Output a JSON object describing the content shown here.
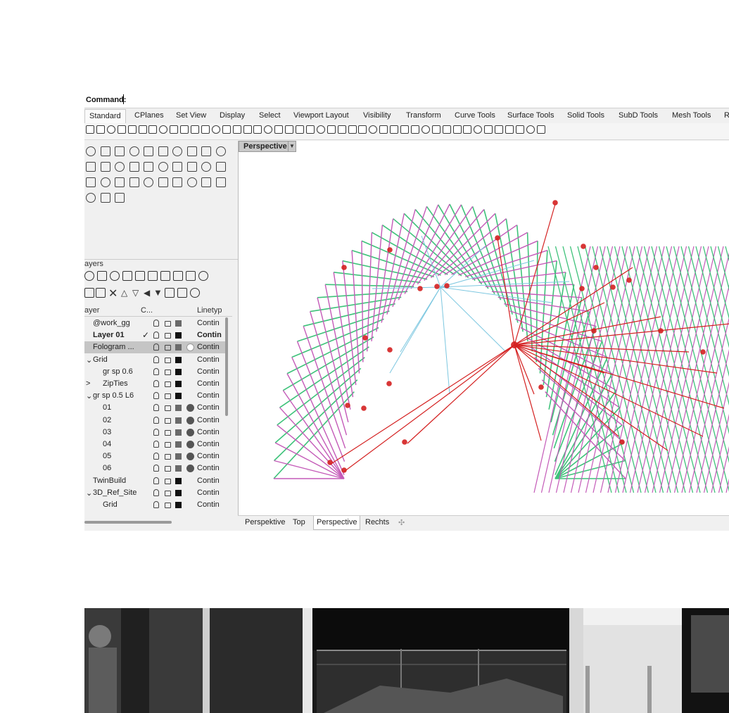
{
  "command_bar": {
    "label": "Command:"
  },
  "ribbon_tabs": [
    "Standard",
    "CPlanes",
    "Set View",
    "Display",
    "Select",
    "Viewport Layout",
    "Visibility",
    "Transform",
    "Curve Tools",
    "Surface Tools",
    "Solid Tools",
    "SubD Tools",
    "Mesh Tools",
    "R"
  ],
  "layers_panel": {
    "title": "ayers",
    "columns": {
      "name": "ayer",
      "color": "C...",
      "linetype": "Linetyp"
    },
    "rows": [
      {
        "prefix": "",
        "name": "@work_gg",
        "linetype": "Contin",
        "swatch": "#6a6a6a",
        "material": ""
      },
      {
        "prefix": "",
        "name": "Layer 01",
        "linetype": "Contin",
        "swatch": "#111111",
        "material": "",
        "current": "✓",
        "bold": true
      },
      {
        "prefix": "",
        "name": "Fologram ...",
        "linetype": "Contin",
        "swatch": "#6a6a6a",
        "material": "#ffffff",
        "selected": true
      },
      {
        "prefix": "⌄",
        "name": "Grid",
        "linetype": "Contin",
        "swatch": "#111111",
        "material": ""
      },
      {
        "prefix": "",
        "name": "gr sp 0.6",
        "linetype": "Contin",
        "swatch": "#111111",
        "material": ""
      },
      {
        "prefix": ">",
        "name": "ZipTies",
        "linetype": "Contin",
        "swatch": "#111111",
        "material": ""
      },
      {
        "prefix": "⌄",
        "name": "gr sp 0.5 L6",
        "linetype": "Contin",
        "swatch": "#111111",
        "material": ""
      },
      {
        "prefix": "",
        "name": "01",
        "linetype": "Contin",
        "swatch": "#6a6a6a",
        "material": "#555555"
      },
      {
        "prefix": "",
        "name": "02",
        "linetype": "Contin",
        "swatch": "#6a6a6a",
        "material": "#555555"
      },
      {
        "prefix": "",
        "name": "03",
        "linetype": "Contin",
        "swatch": "#6a6a6a",
        "material": "#555555"
      },
      {
        "prefix": "",
        "name": "04",
        "linetype": "Contin",
        "swatch": "#6a6a6a",
        "material": "#555555"
      },
      {
        "prefix": "",
        "name": "05",
        "linetype": "Contin",
        "swatch": "#6a6a6a",
        "material": "#555555"
      },
      {
        "prefix": "",
        "name": "06",
        "linetype": "Contin",
        "swatch": "#6a6a6a",
        "material": "#555555"
      },
      {
        "prefix": "",
        "name": "TwinBuild",
        "linetype": "Contin",
        "swatch": "#111111",
        "material": ""
      },
      {
        "prefix": "⌄",
        "name": "3D_Ref_Site",
        "linetype": "Contin",
        "swatch": "#111111",
        "material": ""
      },
      {
        "prefix": "",
        "name": "Grid",
        "linetype": "Contin",
        "swatch": "#111111",
        "material": ""
      }
    ]
  },
  "viewport": {
    "label": "Perspective",
    "colors": {
      "green": "#3ec27a",
      "magenta": "#c45ab8",
      "red": "#d42020",
      "blue": "#7cc7e0"
    }
  },
  "viewport_tabs": [
    "Perspektive",
    "Top",
    "Perspective",
    "Rechts"
  ],
  "viewport_tabs_active": "Perspective"
}
